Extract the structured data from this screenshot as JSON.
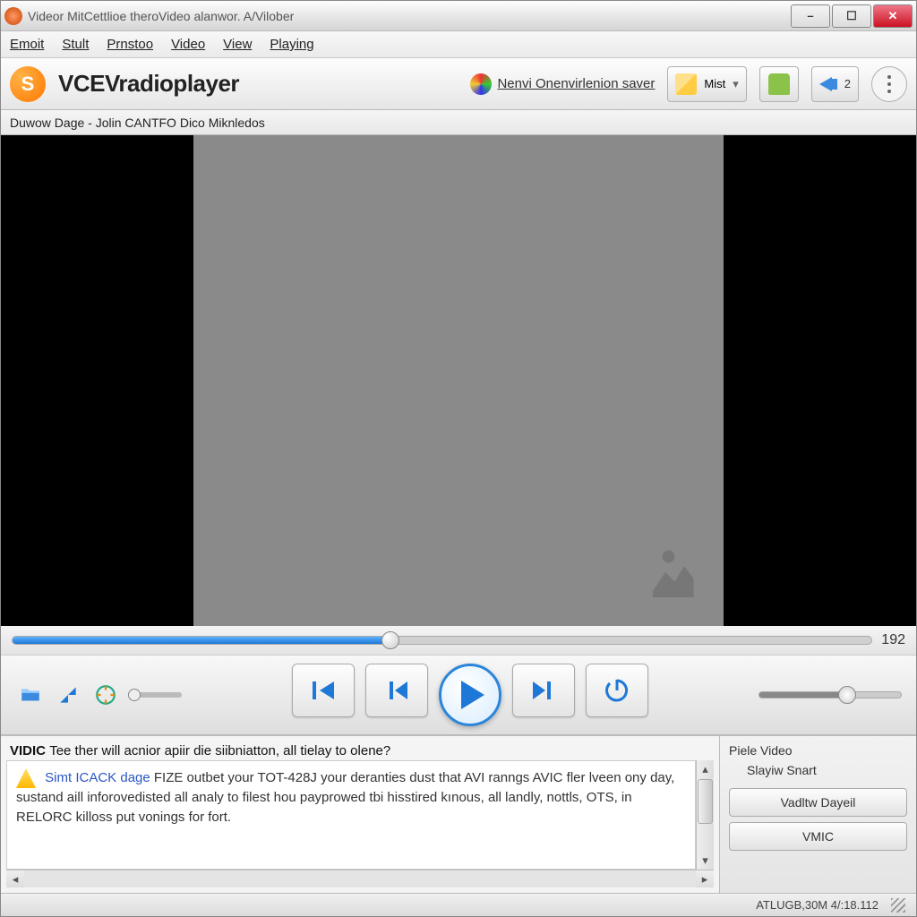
{
  "window": {
    "title": "Videor MitCettlioe theroVideo alanwor. A/Vilober"
  },
  "menu": {
    "items": [
      "Emoit",
      "Stult",
      "Prnstoo",
      "Video",
      "View",
      "Playing"
    ]
  },
  "toolbar": {
    "brand": "VCEVradioplayer",
    "link1": "Nenvi Onenvirlenion saver",
    "dropdown": "Mist",
    "vol_badge": "2"
  },
  "nowplaying": "Duwow Dage - Jolin CANTFO Dico Miknledos",
  "seek": {
    "progress_pct": 44,
    "label": "192"
  },
  "volume": {
    "pct": 62
  },
  "info": {
    "prefix": "VIDIC",
    "header": "Tee ther will acnior apiir die siibniatton, all tielay to olene?",
    "link": "Simt ICACK dage",
    "body1": "FIZE outbet your TOT-428J your deranties dust that AVI ranngs AVIC fler lveen ony day, sustand aill inforovedisted all analy to filest hou payprowed tbi hisstired kınous, all landly, nottls, OTS, in RELORC killoss put vonings for fort."
  },
  "side": {
    "title": "Piele Video",
    "subtitle": "Slayiw Snart",
    "btn1": "Vadltw Dayeil",
    "btn2": "VMIC"
  },
  "status": {
    "text": "ATLUGB,30M 4/:18.112"
  }
}
